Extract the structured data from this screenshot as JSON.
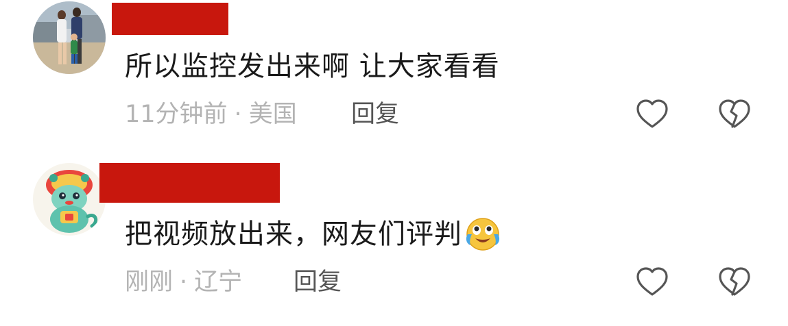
{
  "comments": [
    {
      "avatar": "family-photo-avatar",
      "text": "所以监控发出来啊 让大家看看",
      "time": "11分钟前",
      "separator": "·",
      "location": "美国",
      "reply_label": "回复",
      "like_icon": "heart-outline-icon",
      "dislike_icon": "broken-heart-icon"
    },
    {
      "avatar": "dragon-mascot-avatar",
      "text": "把视频放出来，网友们评判",
      "emoji": "crying-laughing-emoji",
      "time": "刚刚",
      "separator": "·",
      "location": "辽宁",
      "reply_label": "回复",
      "like_icon": "heart-outline-icon",
      "dislike_icon": "broken-heart-icon"
    }
  ],
  "colors": {
    "redaction": "#c8170d",
    "text": "#1a1a1a",
    "meta": "#b3b3b3",
    "reply": "#555555",
    "icon": "#555555"
  }
}
